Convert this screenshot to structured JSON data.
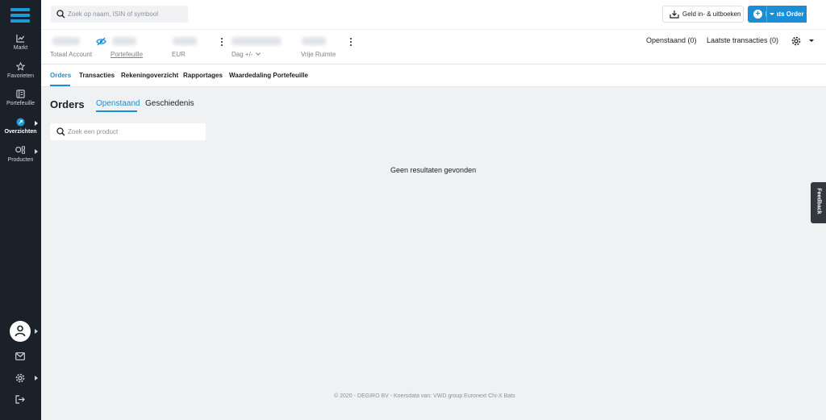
{
  "sidebar": {
    "items": [
      {
        "label": "Markt",
        "icon": "chart-line-icon"
      },
      {
        "label": "Favorieten",
        "icon": "star-icon"
      },
      {
        "label": "Portefeuille",
        "icon": "portfolio-icon"
      },
      {
        "label": "Overzichten",
        "icon": "overview-icon"
      },
      {
        "label": "Producten",
        "icon": "products-icon"
      }
    ]
  },
  "search": {
    "placeholder": "Zoek op naam, ISIN of symbool"
  },
  "header": {
    "money_label": "Geld in- & uitboeken",
    "order_label": "Plaats Order"
  },
  "account": {
    "labels": [
      "Totaal Account",
      "Portefeuille",
      "EUR",
      "Dag +/-",
      "Vrije Ruimte"
    ],
    "openstaand": "Openstaand (0)",
    "laatste": "Laatste transacties (0)"
  },
  "tabs": [
    "Orders",
    "Transacties",
    "Rekeningoverzicht",
    "Rapportages",
    "Waardedaling Portefeuille"
  ],
  "main": {
    "title": "Orders",
    "subtabs": [
      "Openstaand",
      "Geschiedenis"
    ],
    "product_search_placeholder": "Zoek een product",
    "empty": "Geen resultaten gevonden",
    "footer": "© 2020 - DEGIRO BV - Koersdata van: VWD group Euronext Chi-X Bats"
  },
  "feedback": "Feedback",
  "colors": {
    "accent": "#1a8fd6",
    "sidebar": "#1b2128"
  }
}
